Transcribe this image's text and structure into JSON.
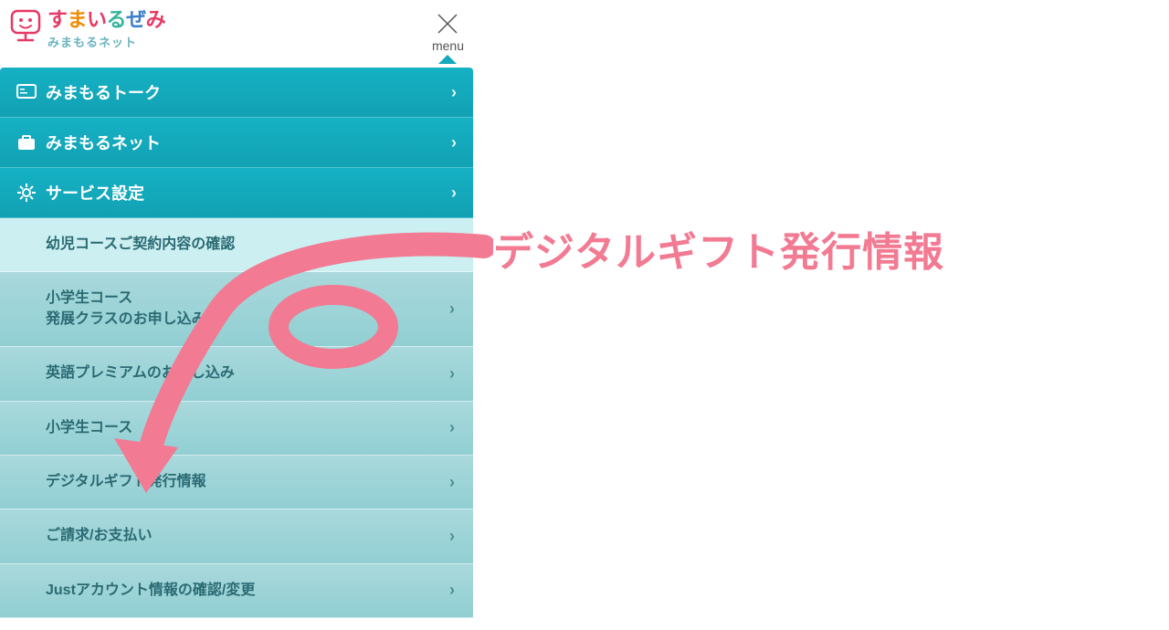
{
  "header": {
    "logo_title_chars": [
      "す",
      "ま",
      "い",
      "る",
      "ぜ",
      "み"
    ],
    "logo_subtitle": "みまもるネット",
    "menu_label": "menu"
  },
  "nav": [
    {
      "id": "talk",
      "label": "みまもるトーク",
      "icon": "chat"
    },
    {
      "id": "net",
      "label": "みまもるネット",
      "icon": "briefcase"
    },
    {
      "id": "settings",
      "label": "サービス設定",
      "icon": "gear"
    }
  ],
  "sub_items": [
    {
      "id": "infant",
      "label": "幼児コースご契約内容の確認",
      "highlight": true
    },
    {
      "id": "elem-advanced",
      "label": "小学生コース\n発展クラスのお申し込み"
    },
    {
      "id": "english",
      "label": "英語プレミアムのお申し込み"
    },
    {
      "id": "elem-course",
      "label": "小学生コース"
    },
    {
      "id": "digital-gift",
      "label": "デジタルギフト発行情報"
    },
    {
      "id": "billing",
      "label": "ご請求/お支払い"
    },
    {
      "id": "just-account",
      "label": "Justアカウント情報の確認/変更"
    }
  ],
  "annotation": {
    "text": "デジタルギフト発行情報"
  },
  "colors": {
    "accent": "#f27a92",
    "nav_bg": "#14a9bc",
    "sub_bg": "#9fd5d9",
    "sub_text": "#2a6a73"
  }
}
